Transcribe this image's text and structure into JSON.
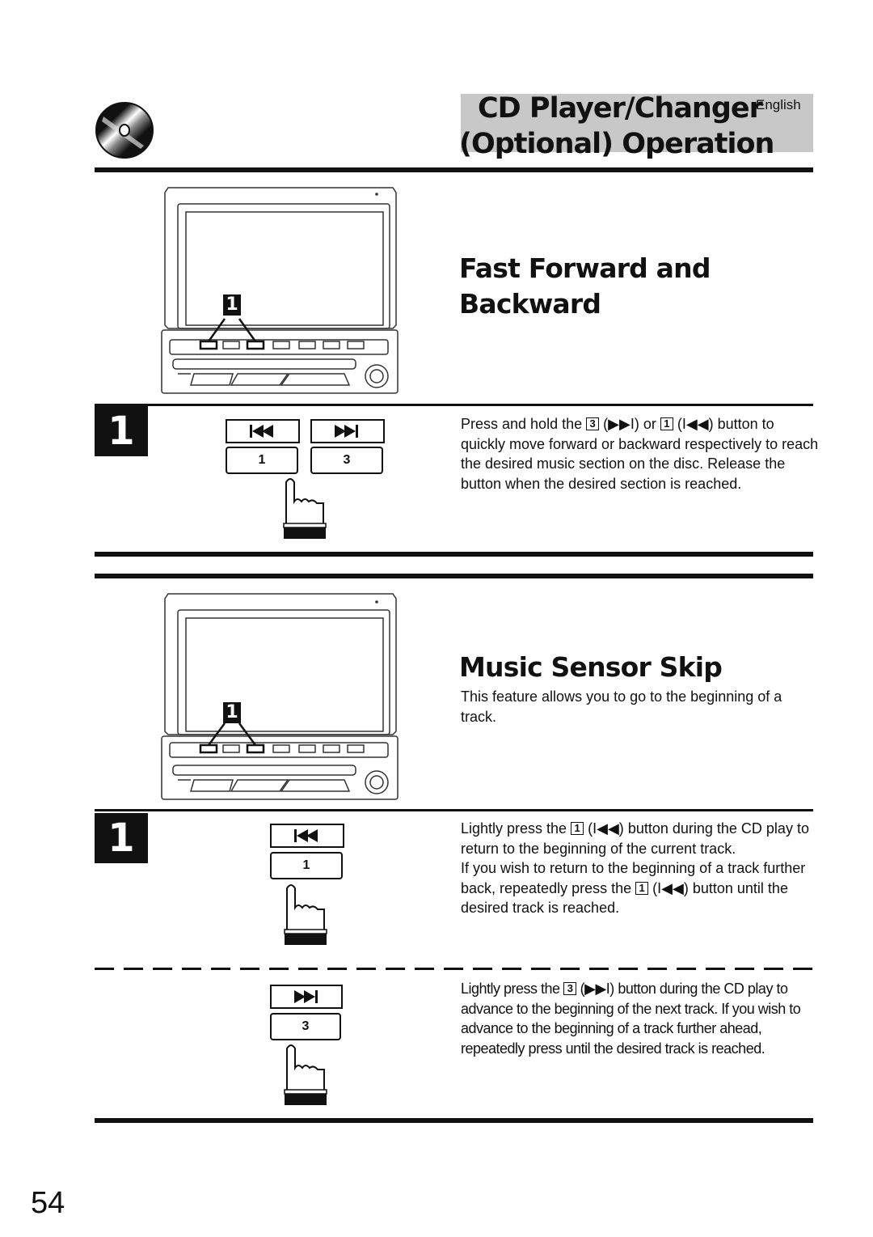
{
  "header": {
    "title_line1": "CD Player/Changer",
    "language": "English",
    "title_line2": "(Optional) Operation",
    "icon": "compact-disc-icon"
  },
  "sections": [
    {
      "title_line1": "Fast Forward and",
      "title_line2": "Backward",
      "diagram": {
        "callout": "1",
        "device_icon": "head-unit-illustration"
      },
      "steps": [
        {
          "number": "1",
          "buttons": [
            {
              "icon": "skip-back-icon",
              "label": "1"
            },
            {
              "icon": "skip-forward-icon",
              "label": "3"
            }
          ],
          "text": {
            "p1": "Press and hold the",
            "key1": "3",
            "sym1": "(▶▶I)",
            "or": "or",
            "key2": "1",
            "sym2": "(I◀◀)",
            "p2": "button to quickly move forward or backward respectively to reach the desired music section on the disc. Release the button when the desired section is reached."
          }
        }
      ]
    },
    {
      "title": "Music Sensor Skip",
      "intro": "This feature allows you to go to the beginning of a track.",
      "diagram": {
        "callout": "1",
        "device_icon": "head-unit-illustration"
      },
      "steps": [
        {
          "number": "1",
          "buttons": [
            {
              "icon": "skip-back-icon",
              "label": "1"
            }
          ],
          "text": {
            "p1": "Lightly press the",
            "key1": "1",
            "sym1": "(I◀◀)",
            "p2": "button during the CD play to return to the beginning of the current track.",
            "p3": "If you wish to return to the beginning of a track further back, repeatedly press the",
            "key2": "1",
            "sym2": "(I◀◀)",
            "p4": "button until the desired track is reached."
          }
        },
        {
          "buttons": [
            {
              "icon": "skip-forward-icon",
              "label": "3"
            }
          ],
          "text": {
            "p1": "Lightly press the",
            "key1": "3",
            "sym1": "(▶▶I)",
            "p2": "button during the CD play to advance to the beginning of the next track. If you wish to advance to the beginning of a track further ahead, repeatedly press until the desired track is reached."
          }
        }
      ]
    }
  ],
  "footer": {
    "page_number": "54"
  }
}
